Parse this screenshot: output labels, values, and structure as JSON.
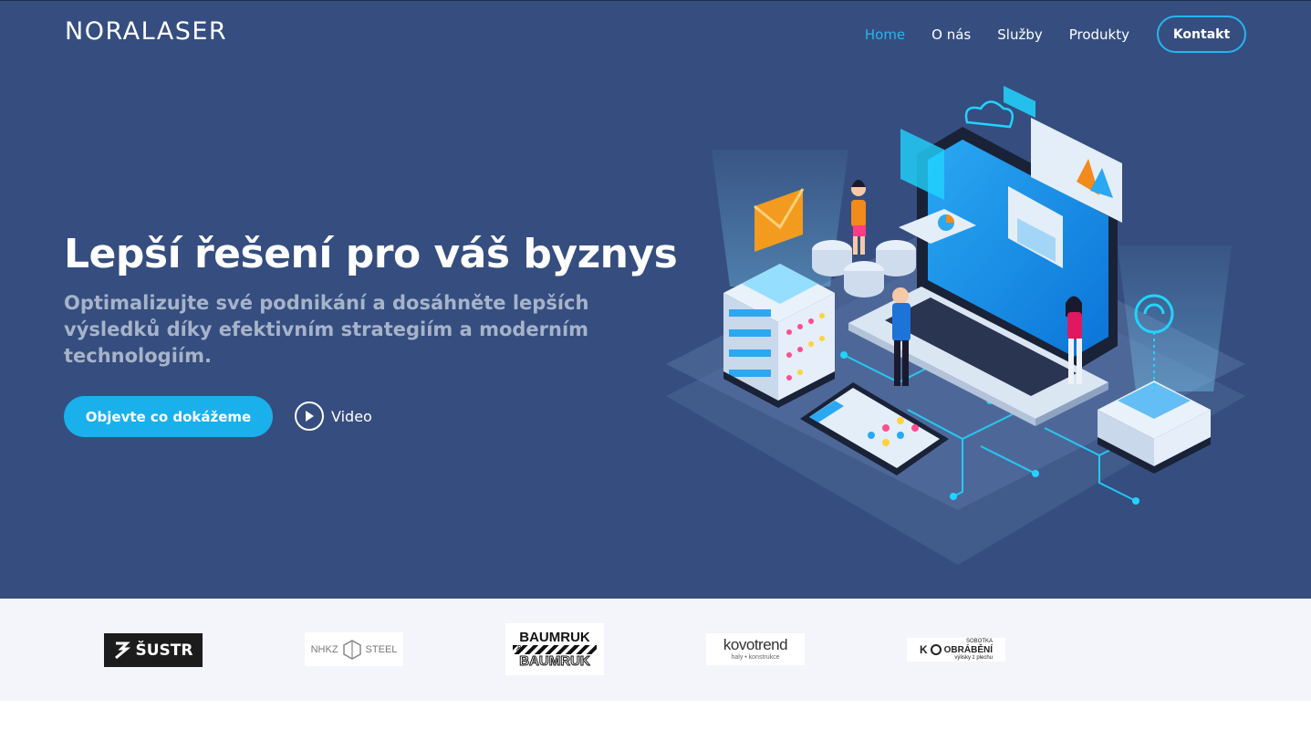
{
  "brand": {
    "logo_text": "NORALASER"
  },
  "nav": {
    "items": [
      {
        "label": "Home",
        "active": true
      },
      {
        "label": "O nás",
        "active": false
      },
      {
        "label": "Služby",
        "active": false
      },
      {
        "label": "Produkty",
        "active": false
      }
    ],
    "cta_label": "Kontakt"
  },
  "hero": {
    "title": "Lepší řešení pro váš byznys",
    "subtitle": "Optimalizujte své podnikání a dosáhněte lepších výsledků díky efektivním strategiím a moderním technologiím.",
    "primary_button": "Objevte co dokážeme",
    "video_button": "Video",
    "illustration_icon": "isometric-tech-illustration-icon"
  },
  "clients": [
    {
      "name": "ŠUSTR",
      "line1": "ŠUSTR"
    },
    {
      "name": "NHKZ STEEL",
      "line1": "NHKZ",
      "line2": "STEEL"
    },
    {
      "name": "BAUMRUK & BAUMRUK",
      "line1": "BAUMRUK",
      "line2": "&",
      "line3": "BAUMRUK"
    },
    {
      "name": "kovotrend",
      "line1": "kovotrend",
      "line2": "haly • konstrukce"
    },
    {
      "name": "SOBOTKA OBRÁBĚNÍ",
      "line1": "K",
      "line2": "OBRÁBĚNÍ",
      "line3": "SOBOTKA",
      "line4": "výlisky z plechu"
    }
  ],
  "colors": {
    "hero_bg": "#354e7f",
    "accent": "#1ab0ec",
    "clients_bg": "#f3f5fa"
  }
}
